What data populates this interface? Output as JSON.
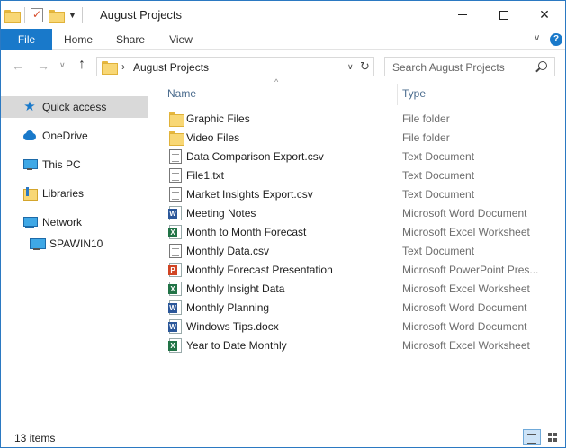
{
  "window": {
    "title": "August Projects"
  },
  "ribbon": {
    "tabs": [
      {
        "label": "File"
      },
      {
        "label": "Home"
      },
      {
        "label": "Share"
      },
      {
        "label": "View"
      }
    ]
  },
  "address": {
    "path": "August Projects",
    "separator": "›"
  },
  "search": {
    "placeholder": "Search August Projects"
  },
  "navigation": {
    "items": [
      {
        "label": "Quick access",
        "icon": "star-icon",
        "selected": true
      },
      {
        "label": "OneDrive",
        "icon": "cloud-icon"
      },
      {
        "label": "This PC",
        "icon": "computer-icon"
      },
      {
        "label": "Libraries",
        "icon": "libraries-icon"
      },
      {
        "label": "Network",
        "icon": "network-icon"
      },
      {
        "label": "SPAWIN10",
        "icon": "computer-icon"
      }
    ]
  },
  "columns": {
    "name": "Name",
    "type": "Type"
  },
  "files": [
    {
      "name": "Graphic Files",
      "type": "File folder",
      "icon": "folder"
    },
    {
      "name": "Video Files",
      "type": "File folder",
      "icon": "folder"
    },
    {
      "name": "Data Comparison Export.csv",
      "type": "Text Document",
      "icon": "text"
    },
    {
      "name": "File1.txt",
      "type": "Text Document",
      "icon": "text"
    },
    {
      "name": "Market Insights Export.csv",
      "type": "Text Document",
      "icon": "text"
    },
    {
      "name": "Meeting Notes",
      "type": "Microsoft Word Document",
      "icon": "doc"
    },
    {
      "name": "Month to Month Forecast",
      "type": "Microsoft Excel Worksheet",
      "icon": "xls"
    },
    {
      "name": "Monthly Data.csv",
      "type": "Text Document",
      "icon": "text"
    },
    {
      "name": "Monthly Forecast Presentation",
      "type": "Microsoft PowerPoint Pres...",
      "icon": "ppt"
    },
    {
      "name": "Monthly Insight Data",
      "type": "Microsoft Excel Worksheet",
      "icon": "xls"
    },
    {
      "name": "Monthly Planning",
      "type": "Microsoft Word Document",
      "icon": "doc"
    },
    {
      "name": "Windows Tips.docx",
      "type": "Microsoft Word Document",
      "icon": "doc"
    },
    {
      "name": "Year to Date Monthly",
      "type": "Microsoft Excel Worksheet",
      "icon": "xls"
    }
  ],
  "status": {
    "count": "13 items"
  },
  "colors": {
    "accent": "#1979ca",
    "selection": "#d9d9d9",
    "header_text": "#4b6c8e"
  }
}
